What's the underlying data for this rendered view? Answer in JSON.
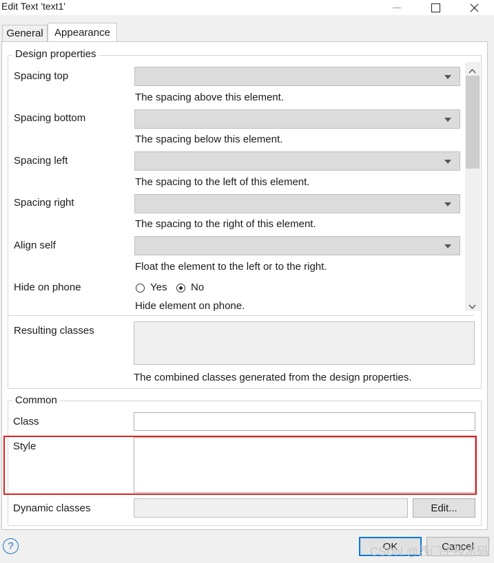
{
  "window": {
    "title": "Edit Text 'text1'"
  },
  "tabs": [
    {
      "label": "General",
      "active": false
    },
    {
      "label": "Appearance",
      "active": true
    }
  ],
  "design_properties": {
    "legend": "Design properties",
    "rows": [
      {
        "label": "Spacing top",
        "value": "",
        "help": "The spacing above this element."
      },
      {
        "label": "Spacing bottom",
        "value": "",
        "help": "The spacing below this element."
      },
      {
        "label": "Spacing left",
        "value": "",
        "help": "The spacing to the left of this element."
      },
      {
        "label": "Spacing right",
        "value": "",
        "help": "The spacing to the right of this element."
      },
      {
        "label": "Align self",
        "value": "",
        "help": "Float the element to the left or to the right."
      }
    ],
    "hide_on_phone": {
      "label": "Hide on phone",
      "options": [
        "Yes",
        "No"
      ],
      "selected": "No",
      "help": "Hide element on phone."
    },
    "resulting_classes": {
      "label": "Resulting classes",
      "value": "",
      "help": "The combined classes generated from the design properties."
    }
  },
  "common": {
    "legend": "Common",
    "class_label": "Class",
    "class_value": "",
    "style_label": "Style",
    "style_value": "",
    "dynamic_classes_label": "Dynamic classes",
    "dynamic_classes_value": "",
    "edit_button": "Edit..."
  },
  "footer": {
    "help_icon": "?",
    "ok_button": "OK",
    "cancel_button": "Cancel"
  },
  "watermark": "CSDN @西门子技术码",
  "colors": {
    "highlight": "#e02020",
    "focus": "#0078d7"
  }
}
